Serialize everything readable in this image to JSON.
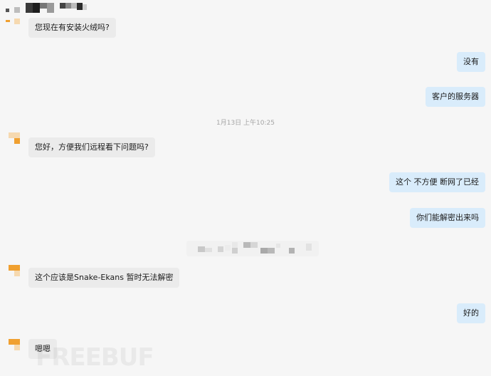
{
  "header": {
    "contact_name_redacted": true
  },
  "messages": [
    {
      "side": "left",
      "text": "您现在有安装火绒吗?"
    },
    {
      "side": "right",
      "text": "没有"
    },
    {
      "side": "right",
      "text": "客户的服务器"
    },
    {
      "side": "left",
      "text": "您好，方便我们远程看下问题吗?"
    },
    {
      "side": "right",
      "text": "这个 不方便 断网了已经"
    },
    {
      "side": "right",
      "text": "你们能解密出来吗"
    },
    {
      "side": "left",
      "text": "这个应该是Snake-Ekans  暂时无法解密"
    },
    {
      "side": "right",
      "text": "好的"
    },
    {
      "side": "left",
      "text": "嗯嗯"
    }
  ],
  "timestamp": "1月13日  上午10:25",
  "watermark": "FREEBUF",
  "colors": {
    "left_bubble": "#ebebeb",
    "right_bubble": "#d9ecfb",
    "avatar_orange": "#f0a030",
    "avatar_light": "#f6d9b0"
  }
}
